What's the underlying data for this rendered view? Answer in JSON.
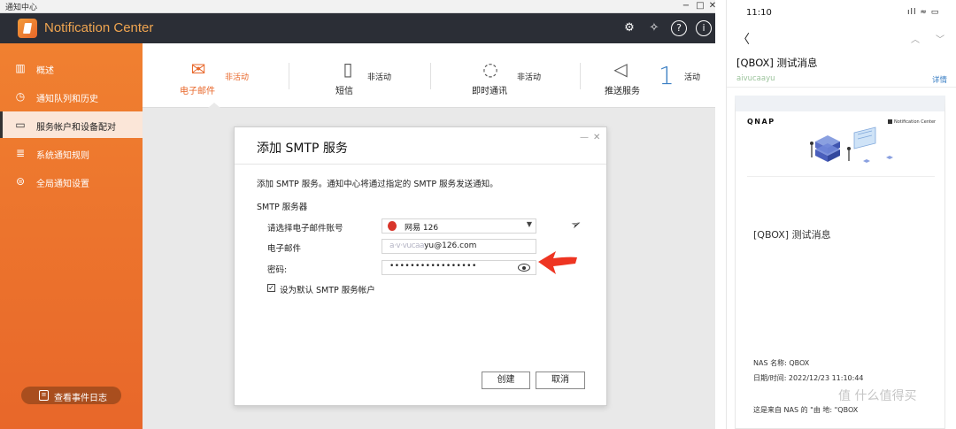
{
  "window": {
    "title": "通知中心",
    "app_title": "Notification Center"
  },
  "sidebar": {
    "items": [
      {
        "label": "概述",
        "icon": "bar-chart-icon"
      },
      {
        "label": "通知队列和历史",
        "icon": "history-icon"
      },
      {
        "label": "服务帐户和设备配对",
        "icon": "laptop-icon"
      },
      {
        "label": "系统通知规则",
        "icon": "rules-icon"
      },
      {
        "label": "全局通知设置",
        "icon": "settings-toggle-icon"
      }
    ],
    "active_index": 2,
    "event_log_label": "查看事件日志"
  },
  "channels": [
    {
      "name": "电子邮件",
      "status": "非活动",
      "icon": "email-icon",
      "selected": true
    },
    {
      "name": "短信",
      "status": "非活动",
      "icon": "sms-icon",
      "selected": false
    },
    {
      "name": "即时通讯",
      "status": "非活动",
      "icon": "chat-icon",
      "selected": false
    },
    {
      "name": "推送服务",
      "status": "活动",
      "count": "1",
      "icon": "megaphone-icon",
      "selected": false
    }
  ],
  "dialog": {
    "title": "添加 SMTP 服务",
    "description": "添加 SMTP 服务。通知中心将通过指定的 SMTP 服务发送通知。",
    "section_label": "SMTP 服务器",
    "account_label": "请选择电子邮件账号",
    "account_value": "网易 126",
    "email_label": "电子邮件",
    "email_blurred": "a·v·vucaa",
    "email_suffix": "yu@126.com",
    "password_label": "密码:",
    "password_value": "•••••••••••••••••",
    "default_checkbox_label": "设为默认 SMTP 服务帐户",
    "default_checked": true,
    "create_label": "创建",
    "cancel_label": "取消"
  },
  "phone": {
    "time": "11:10",
    "status_icons": "ıll ≈ ▭",
    "subject": "[QBOX] 测试消息",
    "from_blurred": "aivucaayu",
    "detail_label": "详情",
    "card": {
      "brand": "QNAP",
      "app_tag": "Notification Center",
      "title": "[QBOX] 测试消息",
      "nas_name_line": "NAS 名称: QBOX",
      "datetime_line": "日期/时间: 2022/12/23 11:10:44",
      "footer_line": "这是来自 NAS 的 \"由 地: \"QBOX"
    },
    "watermark": "值 什么值得买"
  }
}
